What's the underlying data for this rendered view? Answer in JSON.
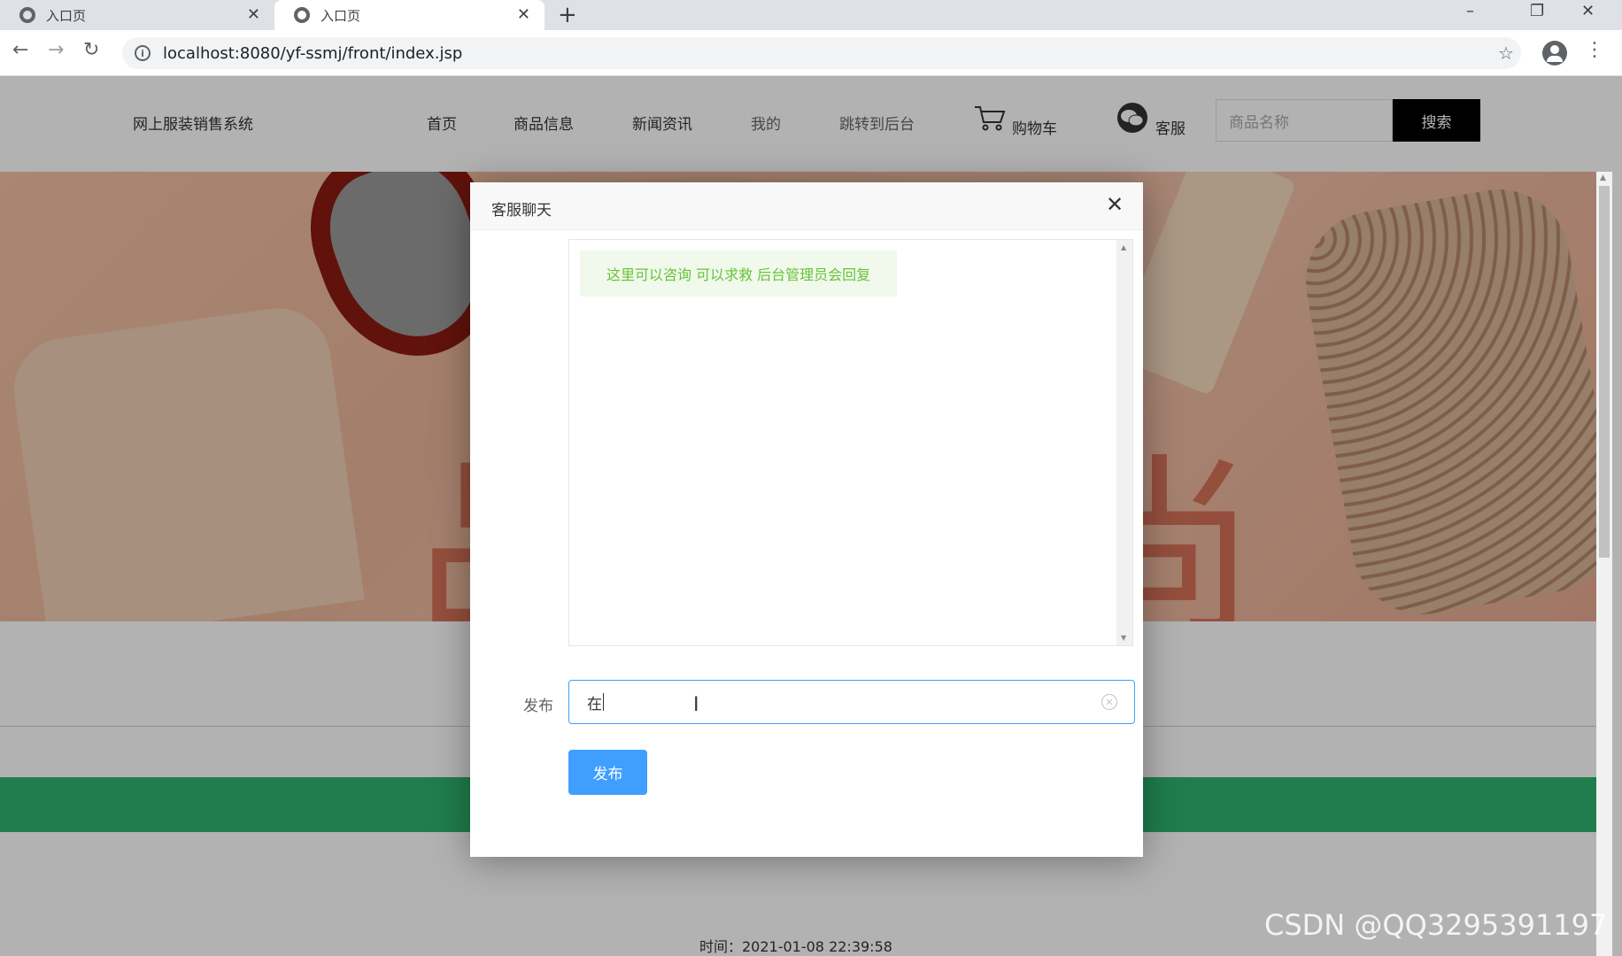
{
  "browser": {
    "tabs": [
      {
        "title": "入口页",
        "active": false
      },
      {
        "title": "入口页",
        "active": true
      }
    ],
    "new_tab_symbol": "+",
    "url": "localhost:8080/yf-ssmj/front/index.jsp",
    "window_controls": {
      "minimize": "–",
      "restore": "❐",
      "close": "✕"
    }
  },
  "header": {
    "site_title": "网上服装销售系统",
    "nav": [
      "首页",
      "商品信息",
      "新闻资讯",
      "我的",
      "跳转到后台"
    ],
    "cart_label": "购物车",
    "service_label": "客服",
    "search_placeholder": "商品名称",
    "search_button": "搜索"
  },
  "banner": {
    "chars": [
      "品",
      "尚"
    ]
  },
  "footer": {
    "time_text": "时间：2021-01-08 22:39:58"
  },
  "modal": {
    "title": "客服聊天",
    "close_symbol": "✕",
    "messages": [
      "这里可以咨询 可以求救 后台管理员会回复"
    ],
    "input_label": "发布",
    "input_value": "在",
    "submit_label": "发布"
  },
  "watermark": "CSDN @QQ3295391197",
  "colors": {
    "primary": "#409eff",
    "green": "#2fb36f",
    "msg_bg": "#f0f9eb",
    "msg_text": "#67c23a"
  },
  "icons": [
    "globe-icon",
    "close-icon",
    "back-icon",
    "forward-icon",
    "reload-icon",
    "info-icon",
    "star-icon",
    "profile-icon",
    "menu-icon",
    "cart-icon",
    "wechat-icon",
    "clear-icon"
  ]
}
